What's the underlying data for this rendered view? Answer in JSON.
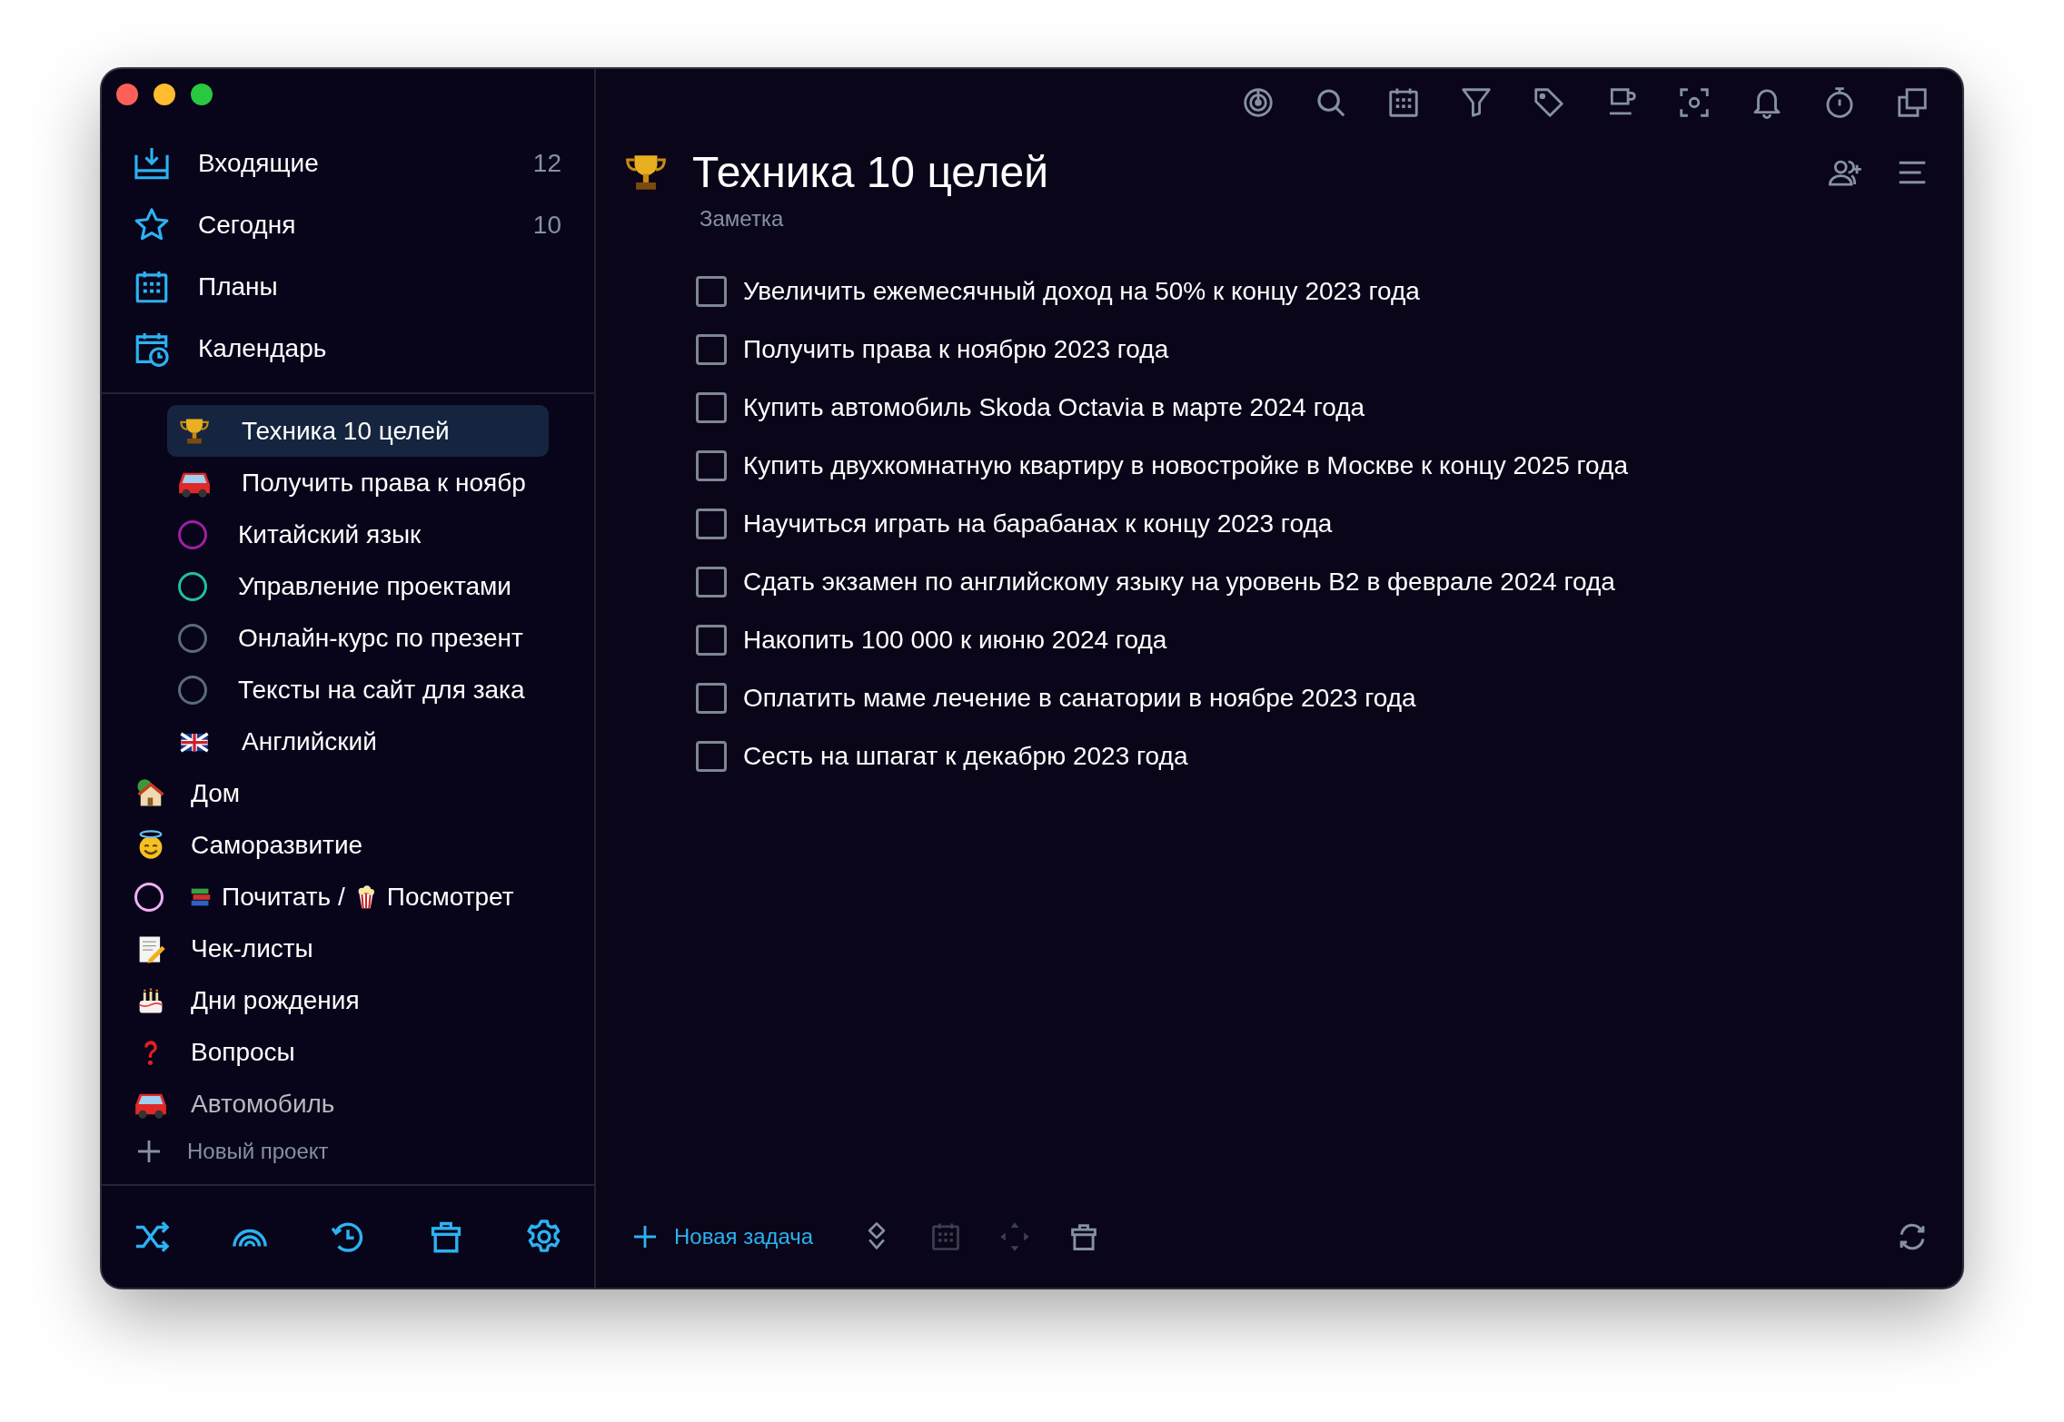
{
  "sidebar": {
    "nav": [
      {
        "label": "Входящие",
        "count": "12",
        "selected": false
      },
      {
        "label": "Сегодня",
        "count": "10",
        "selected": false
      },
      {
        "label": "Планы",
        "selected": false
      },
      {
        "label": "Календарь",
        "selected": false
      }
    ],
    "sub_projects": [
      {
        "kind": "icon",
        "label": "Техника 10 целей",
        "selected": true
      },
      {
        "kind": "icon",
        "label": "Получить права к ноябр",
        "selected": false
      },
      {
        "kind": "circle",
        "color": "#a020a0",
        "label": "Китайский язык",
        "selected": false
      },
      {
        "kind": "circle",
        "color": "#20c0a0",
        "label": "Управление проектами",
        "selected": false
      },
      {
        "kind": "circle",
        "color": "#5a6b7b",
        "label": "Онлайн-курс по презент",
        "selected": false
      },
      {
        "kind": "circle",
        "color": "#5a6b7b",
        "label": "Тексты на сайт для зака",
        "selected": false
      },
      {
        "kind": "icon",
        "label": "Английский",
        "selected": false
      }
    ],
    "projects": [
      {
        "kind": "icon",
        "label": "Дом",
        "selected": false
      },
      {
        "kind": "icon",
        "label": "Саморазвитие",
        "selected": false
      },
      {
        "kind": "circle",
        "color": "#f0b0f0",
        "parts": [
          "Почитать /",
          "Посмотрет"
        ],
        "selected": false
      },
      {
        "kind": "icon",
        "label": "Чек-листы",
        "selected": false
      },
      {
        "kind": "icon",
        "label": "Дни рождения",
        "selected": false
      },
      {
        "kind": "icon",
        "label": "Вопросы",
        "selected": false
      },
      {
        "kind": "icon",
        "label": "Автомобиль",
        "selected": false
      }
    ],
    "new_project": "Новый проект"
  },
  "header": {
    "title": "Техника 10 целей",
    "subtitle": "Заметка"
  },
  "tasks": [
    {
      "text": "Увеличить ежемесячный доход на 50% к концу 2023 года",
      "checked": false
    },
    {
      "text": "Получить права к ноябрю 2023 года",
      "checked": false
    },
    {
      "text": "Купить автомобиль Skoda Octavia в марте 2024 года",
      "checked": false
    },
    {
      "text": "Купить двухкомнатную квартиру в новостройке в Москве к концу 2025 года",
      "checked": false
    },
    {
      "text": "Научиться играть на барабанах к концу 2023 года",
      "checked": false
    },
    {
      "text": "Сдать экзамен по английскому языку на уровень B2 в феврале 2024 года",
      "checked": false
    },
    {
      "text": "Накопить 100 000 к июню 2024 года",
      "checked": false
    },
    {
      "text": "Оплатить маме лечение в санатории в ноябре 2023 года",
      "checked": false
    },
    {
      "text": "Сесть на шпагат к декабрю 2023 года",
      "checked": false
    }
  ],
  "footer": {
    "new_task": "Новая задача",
    "tools": [
      {
        "disabled": false
      },
      {
        "disabled": true
      },
      {
        "disabled": true
      },
      {
        "disabled": false
      }
    ]
  }
}
